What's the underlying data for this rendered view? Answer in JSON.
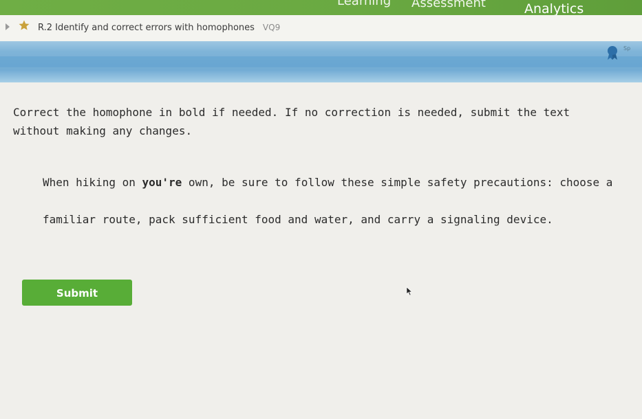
{
  "nav": {
    "tabs": [
      "Learning",
      "Assessment",
      "Analytics"
    ]
  },
  "skill": {
    "title": "R.2 Identify and correct errors with homophones",
    "code": "VQ9"
  },
  "award": {
    "icon": "award-ribbon-icon",
    "label": "Sp"
  },
  "question": {
    "instructions": "Correct the homophone in bold if needed. If no correction is needed, submit the text without making any changes.",
    "passage_before": "When hiking on ",
    "passage_bold": "you're",
    "passage_after_line1": " own, be sure to follow these simple safety precautions: choose a",
    "passage_line2": "familiar route, pack sufficient food and water, and carry a signaling device."
  },
  "submit": {
    "label": "Submit"
  },
  "colors": {
    "nav_green": "#6aa942",
    "submit_green": "#58ad37",
    "progress_blue": "#73acd4",
    "star_gold": "#c9a13a"
  }
}
